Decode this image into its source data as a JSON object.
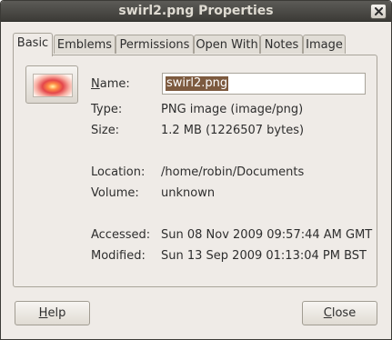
{
  "window": {
    "title": "swirl2.png Properties"
  },
  "tabs": [
    {
      "label": "Basic",
      "active": true
    },
    {
      "label": "Emblems"
    },
    {
      "label": "Permissions"
    },
    {
      "label": "Open With"
    },
    {
      "label": "Notes"
    },
    {
      "label": "Image"
    }
  ],
  "basic": {
    "name_label_mnemonic": "N",
    "name_label_rest": "ame:",
    "name_value": "swirl2.png",
    "type_label": "Type:",
    "type_value": "PNG image (image/png)",
    "size_label": "Size:",
    "size_value": "1.2 MB (1226507 bytes)",
    "location_label": "Location:",
    "location_value": "/home/robin/Documents",
    "volume_label": "Volume:",
    "volume_value": "unknown",
    "accessed_label": "Accessed:",
    "accessed_value": "Sun 08 Nov 2009 09:57:44 AM GMT",
    "modified_label": "Modified:",
    "modified_value": "Sun 13 Sep 2009 01:13:04 PM BST"
  },
  "buttons": {
    "help_mnemonic": "H",
    "help_rest": "elp",
    "close_mnemonic": "C",
    "close_rest": "lose"
  },
  "colors": {
    "titlebar": "#3c3b37",
    "window_bg": "#efebe7",
    "selection": "#7d5a3f"
  },
  "icons": {
    "close": "close-icon",
    "thumbnail": "image-thumbnail-icon"
  }
}
